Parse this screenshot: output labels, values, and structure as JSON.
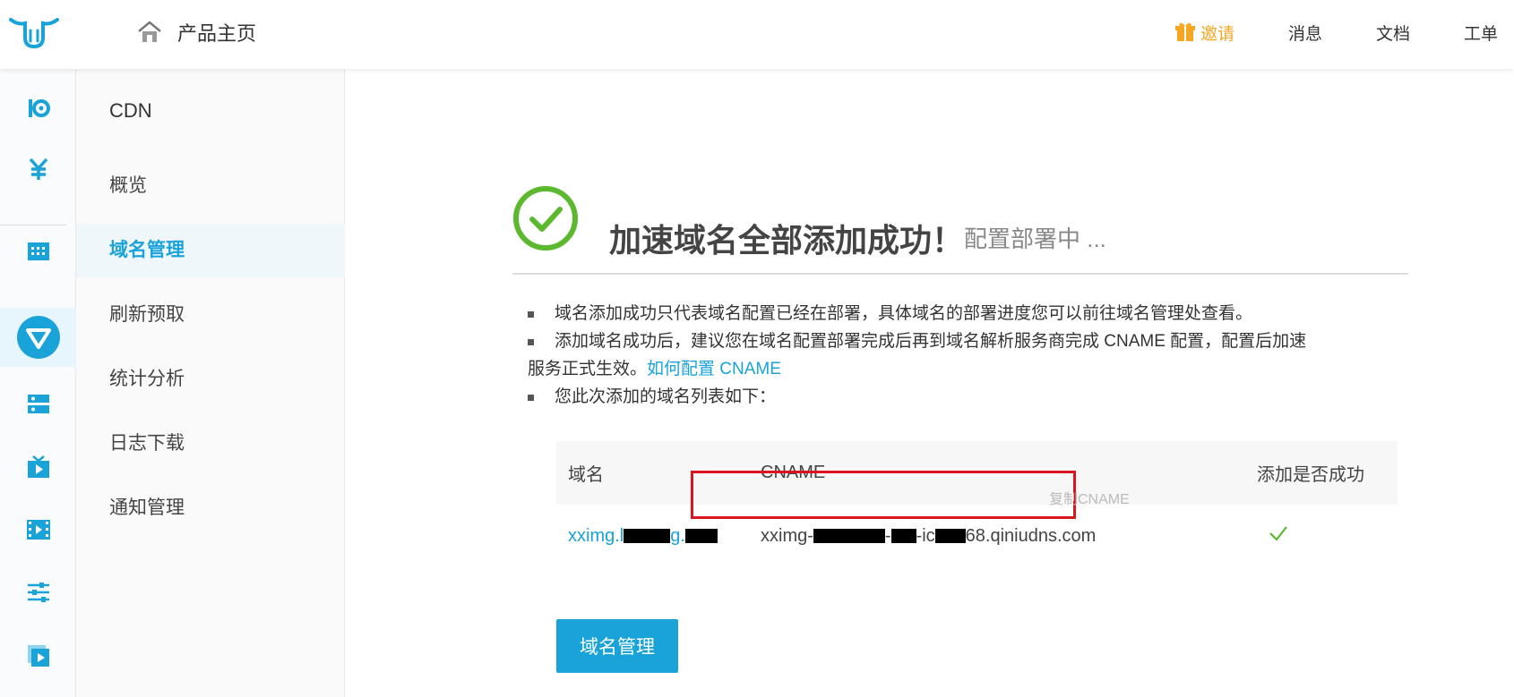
{
  "header": {
    "home_label": "产品主页",
    "invite_label": "邀请",
    "messages_label": "消息",
    "docs_label": "文档",
    "tickets_label": "工单"
  },
  "colors": {
    "accent": "#1aa3d9",
    "invite": "#f5a623",
    "success": "#5cb82e",
    "highlight": "#d9161f"
  },
  "rail": {
    "icons": [
      "kodo-icon",
      "billing-yen-icon",
      "grid-icon",
      "cdn-icon",
      "storage-icon",
      "live-icon",
      "video-icon",
      "settings-sliders-icon",
      "media-play-icon"
    ],
    "active": "cdn-icon"
  },
  "subnav": {
    "title": "CDN",
    "items": [
      {
        "label": "概览"
      },
      {
        "label": "域名管理",
        "active": true
      },
      {
        "label": "刷新预取"
      },
      {
        "label": "统计分析"
      },
      {
        "label": "日志下载"
      },
      {
        "label": "通知管理"
      }
    ]
  },
  "main": {
    "title": "加速域名全部添加成功！",
    "subtitle": "配置部署中 ...",
    "note1": "域名添加成功只代表域名配置已经在部署，具体域名的部署进度您可以前往域名管理处查看。",
    "note2_a": "添加域名成功后，建议您在域名配置部署完成后再到域名解析服务商完成 CNAME 配置，配置后加速",
    "note2_b": "服务正式生效。",
    "note2_link": "如何配置 CNAME",
    "note3": "您此次添加的域名列表如下：",
    "table": {
      "headers": [
        "域名",
        "CNAME",
        "添加是否成功"
      ],
      "rows": [
        {
          "domain_a": "xximg.l",
          "domain_b": "g.",
          "cname_a": "xximg-",
          "cname_b": "-",
          "cname_c": "-ic",
          "cname_d": "68.qiniudns.com",
          "copy": "复制CNAME"
        }
      ]
    },
    "button": "域名管理"
  }
}
